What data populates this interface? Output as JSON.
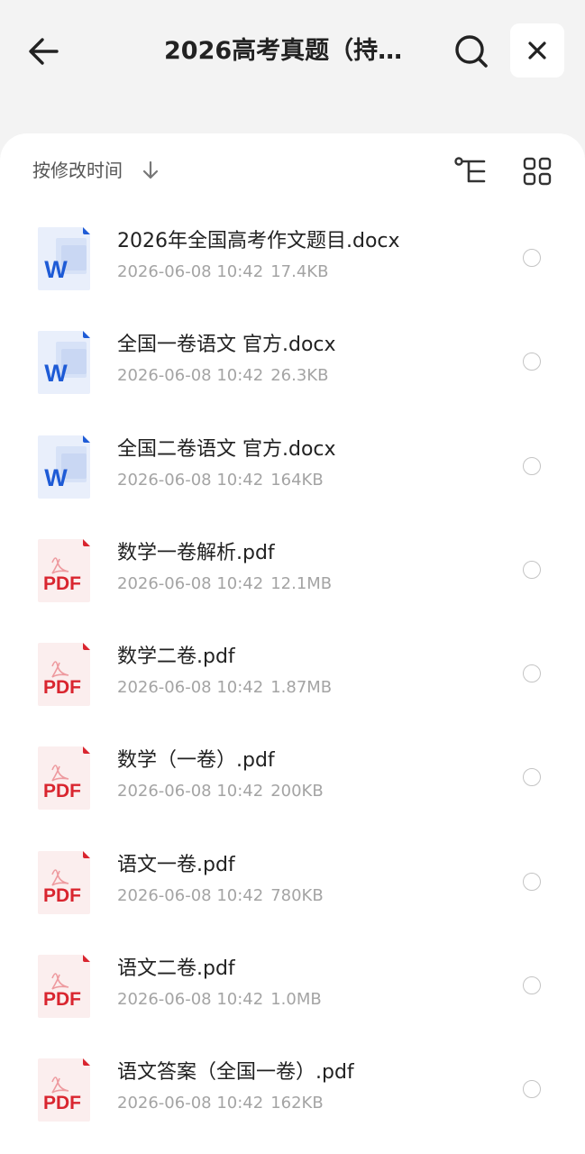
{
  "header": {
    "title": "2026高考真题（持…",
    "back_icon": "arrow-left-icon",
    "search_icon": "search-icon",
    "close_icon": "close-icon"
  },
  "toolbar": {
    "sort_label": "按修改时间",
    "sort_icon": "arrow-down-icon",
    "tree_icon": "tree-view-icon",
    "grid_icon": "grid-view-icon"
  },
  "files": [
    {
      "name": "2026年全国高考作文题目.docx",
      "date": "2026-06-08 10:42",
      "size": "17.4KB",
      "type": "word"
    },
    {
      "name": "全国一卷语文 官方.docx",
      "date": "2026-06-08 10:42",
      "size": "26.3KB",
      "type": "word"
    },
    {
      "name": "全国二卷语文  官方.docx",
      "date": "2026-06-08 10:42",
      "size": "164KB",
      "type": "word"
    },
    {
      "name": "数学一卷解析.pdf",
      "date": "2026-06-08 10:42",
      "size": "12.1MB",
      "type": "pdf"
    },
    {
      "name": "数学二卷.pdf",
      "date": "2026-06-08 10:42",
      "size": "1.87MB",
      "type": "pdf"
    },
    {
      "name": "数学（一卷）.pdf",
      "date": "2026-06-08 10:42",
      "size": "200KB",
      "type": "pdf"
    },
    {
      "name": "语文一卷.pdf",
      "date": "2026-06-08 10:42",
      "size": "780KB",
      "type": "pdf"
    },
    {
      "name": "语文二卷.pdf",
      "date": "2026-06-08 10:42",
      "size": "1.0MB",
      "type": "pdf"
    },
    {
      "name": "语文答案（全国一卷）.pdf",
      "date": "2026-06-08 10:42",
      "size": "162KB",
      "type": "pdf"
    }
  ],
  "icon_labels": {
    "word": "W",
    "pdf": "PDF"
  },
  "colors": {
    "word_blue": "#1e5bd6",
    "pdf_red": "#d9252f",
    "meta_gray": "#a4a4a4"
  }
}
